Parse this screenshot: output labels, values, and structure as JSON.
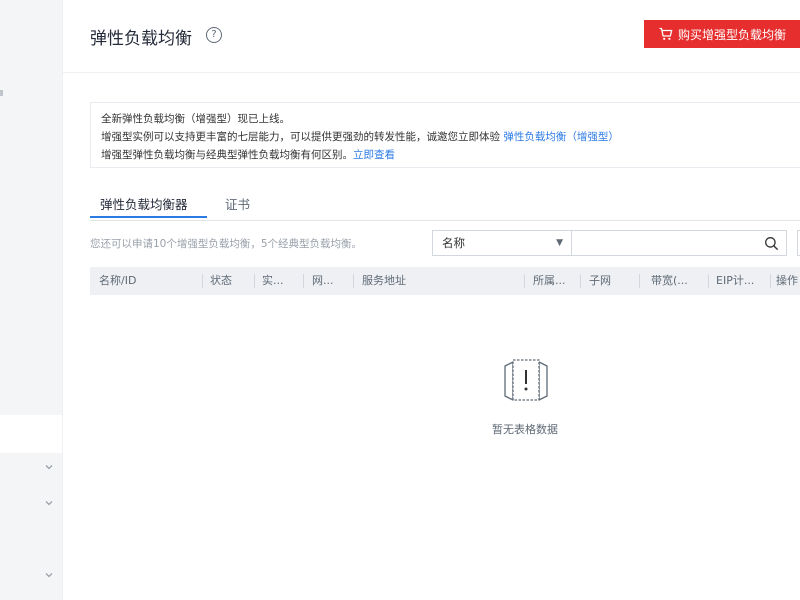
{
  "header": {
    "title": "弹性负载均衡",
    "help_symbol": "?",
    "buy_button_label": "购买增强型负载均衡"
  },
  "notice": {
    "line1": "全新弹性负载均衡（增强型）现已上线。",
    "line2_text": "增强型实例可以支持更丰富的七层能力，可以提供更强劲的转发性能，诚邀您立即体验 ",
    "line2_link": "弹性负载均衡（增强型）",
    "line3_text": "增强型弹性负载均衡与经典型弹性负载均衡有何区别。",
    "line3_link": "立即查看"
  },
  "tabs": [
    {
      "label": "弹性负载均衡器",
      "active": true
    },
    {
      "label": "证书",
      "active": false
    }
  ],
  "quota_text": "您还可以申请10个增强型负载均衡，5个经典型负载均衡。",
  "filter": {
    "selected": "名称",
    "search_value": ""
  },
  "table": {
    "columns": [
      "名称/ID",
      "状态",
      "实...",
      "网...",
      "服务地址",
      "所属...",
      "子网",
      "带宽(...",
      "EIP计...",
      "操作"
    ]
  },
  "empty_state": {
    "text": "暂无表格数据"
  },
  "colors": {
    "primary_red": "#e62e2e",
    "link_blue": "#2c7be5",
    "table_header_bg": "#eef0f3"
  },
  "icons": {
    "help": "question-circle-icon",
    "cart": "cart-icon",
    "search": "search-icon",
    "dropdown": "caret-down-icon",
    "empty": "empty-document-icon"
  }
}
